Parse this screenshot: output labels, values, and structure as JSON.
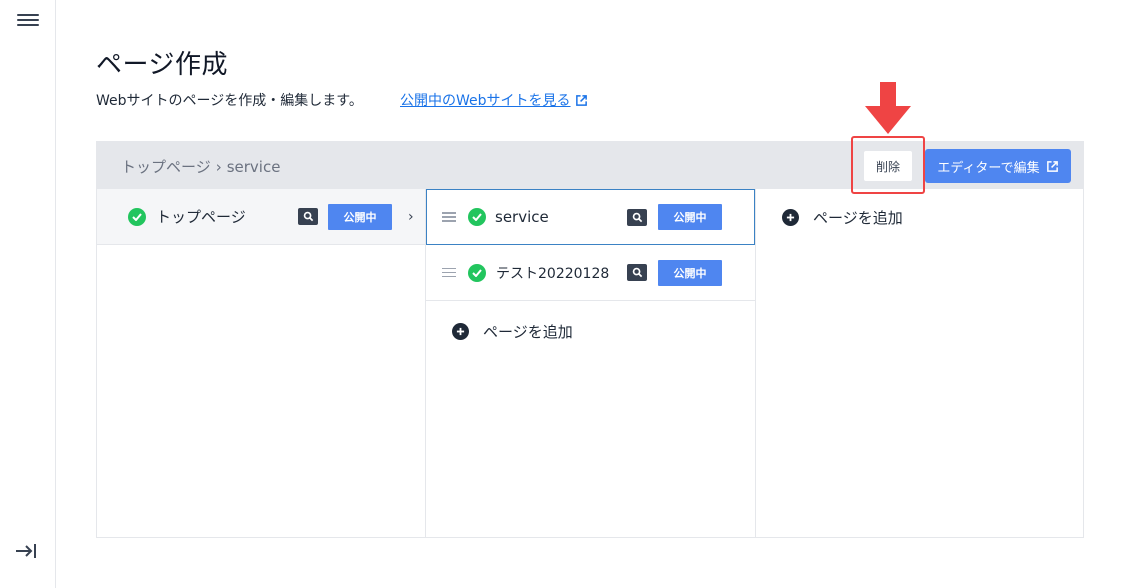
{
  "rail": {
    "menu_icon": "hamburger-menu-icon",
    "collapse_icon": "arrow-right-to-bar-icon"
  },
  "header": {
    "title": "ページ作成",
    "subtitle": "Webサイトのページを作成・編集します。",
    "site_link_label": "公開中のWebサイトを見る",
    "site_link_icon": "external-link-icon"
  },
  "toolbar": {
    "breadcrumb": [
      "トップページ",
      "service"
    ],
    "breadcrumb_separator": "›",
    "delete_label": "削除",
    "editor_label": "エディターで編集",
    "editor_icon": "external-link-icon"
  },
  "columns": [
    {
      "rows": [
        {
          "label": "トップページ",
          "status": "公開中",
          "has_children": true
        }
      ]
    },
    {
      "rows": [
        {
          "label": "service",
          "status": "公開中"
        },
        {
          "label": "テスト20220128",
          "status": "公開中"
        }
      ],
      "add_label": "ページを追加"
    },
    {
      "rows": [],
      "add_label": "ページを追加"
    }
  ],
  "annotation": {
    "arrow_color": "#ef4444",
    "highlight_color": "#ef4444"
  },
  "colors": {
    "accent": "#4f86f0",
    "published_check": "#22c55e",
    "link": "#1a73e8"
  }
}
